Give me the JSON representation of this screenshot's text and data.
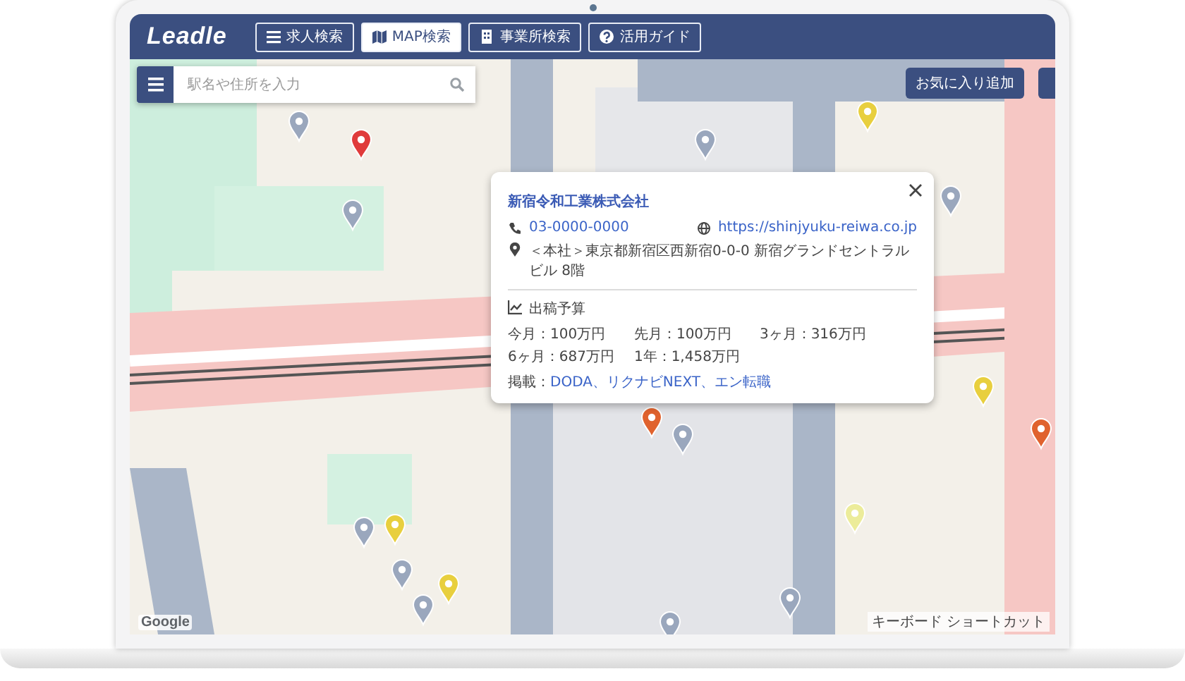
{
  "header": {
    "logo": "Leadle",
    "nav": [
      {
        "kind": "list",
        "label": "求人検索",
        "selected": false
      },
      {
        "kind": "map",
        "label": "MAP検索",
        "selected": true
      },
      {
        "kind": "building",
        "label": "事業所検索",
        "selected": false
      },
      {
        "kind": "help",
        "label": "活用ガイド",
        "selected": false
      }
    ]
  },
  "search": {
    "placeholder": "駅名や住所を入力"
  },
  "favorite_button": "お気に入り追加",
  "popup": {
    "company": "新宿令和工業株式会社",
    "phone": "03-0000-0000",
    "website": "https://shinjyuku-reiwa.co.jp",
    "address": "＜本社＞東京都新宿区西新宿0-0-0 新宿グランドセントラルビル 8階",
    "budget_title": "出稿予算",
    "budgets": [
      "今月：100万円",
      "先月：100万円",
      "3ヶ月：316万円",
      "6ヶ月：687万円",
      "1年：1,458万円"
    ],
    "listing_label": "掲載：",
    "listing_sites": "DODA、リクナビNEXT、エン転職"
  },
  "map_attribution": {
    "logo": "Google",
    "shortcuts": "キーボード ショートカット"
  }
}
